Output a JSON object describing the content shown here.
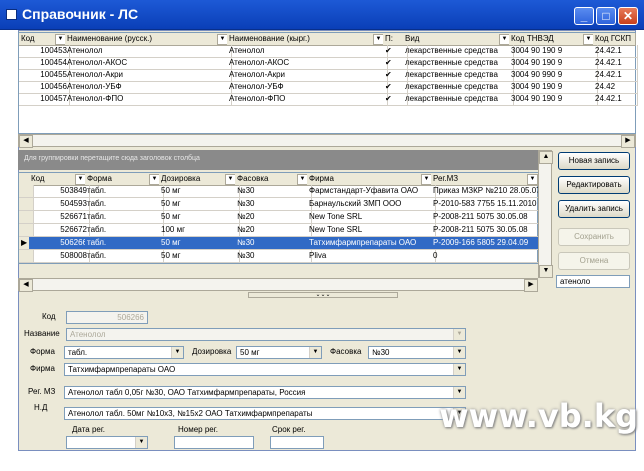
{
  "window": {
    "title": "Справочник - ЛС",
    "controls": {
      "minimize": "_",
      "maximize": "□",
      "close": "✕"
    }
  },
  "top_grid": {
    "columns": [
      "Код",
      "Наименование (русск.)",
      "Наименование (кырг.)",
      "П:",
      "Вид",
      "Код ТНВЭД",
      "Код ГСКП"
    ],
    "rows": [
      {
        "code": "100453",
        "name_ru": "Атенолол",
        "name_kg": "Атенолол",
        "check": "✔",
        "type": "лекарственные средства",
        "tnved": "3004 90 190 9",
        "gskp": "24.42.1"
      },
      {
        "code": "100454",
        "name_ru": "Атенолол-АКОС",
        "name_kg": "Атенолол-АКОС",
        "check": "✔",
        "type": "лекарственные средства",
        "tnved": "3004 90 190 9",
        "gskp": "24.42.1"
      },
      {
        "code": "100455",
        "name_ru": "Атенолол-Акри",
        "name_kg": "Атенолол-Акри",
        "check": "✔",
        "type": "лекарственные средства",
        "tnved": "3004 90 990 9",
        "gskp": "24.42.1"
      },
      {
        "code": "100456",
        "name_ru": "Атенолол-УБФ",
        "name_kg": "Атенолол-УБФ",
        "check": "✔",
        "type": "лекарственные средства",
        "tnved": "3004 90 190 9",
        "gskp": "24.42"
      },
      {
        "code": "100457",
        "name_ru": "Атенолол-ФПО",
        "name_kg": "Атенолол-ФПО",
        "check": "✔",
        "type": "лекарственные средства",
        "tnved": "3004 90 190 9",
        "gskp": "24.42.1"
      }
    ]
  },
  "group_hint": "Для группировки перетащите сюда заголовок столбца",
  "bottom_grid": {
    "columns": [
      "Код",
      "Форма",
      "Дозировка",
      "Фасовка",
      "Фирма",
      "Рег.МЗ"
    ],
    "rows": [
      {
        "code": "503849",
        "form": "табл.",
        "dose": "50 мг",
        "pack": "№30",
        "firm": "Фармстандарт-Уфавита ОАО",
        "reg": "Приказ МЗКР №210 28.05.07",
        "selected": false
      },
      {
        "code": "504593",
        "form": "табл.",
        "dose": "50 мг",
        "pack": "№30",
        "firm": "Барнаульский ЗМП ООО",
        "reg": "Р-2010-583 7755  15.11.2010",
        "selected": false
      },
      {
        "code": "526671",
        "form": "табл.",
        "dose": "50 мг",
        "pack": "№20",
        "firm": "New Tone SRL",
        "reg": "Р-2008-211 5075 30.05.08",
        "selected": false
      },
      {
        "code": "526672",
        "form": "табл.",
        "dose": "100 мг",
        "pack": "№20",
        "firm": "New Tone SRL",
        "reg": "Р-2008-211 5075 30.05.08",
        "selected": false
      },
      {
        "code": "506266",
        "form": "табл.",
        "dose": "50 мг",
        "pack": "№30",
        "firm": "Татхимфармпрепараты ОАО",
        "reg": "Р-2009-166 5805 29.04.09",
        "selected": true
      },
      {
        "code": "508008",
        "form": "табл.",
        "dose": "50 мг",
        "pack": "№30",
        "firm": "Pliva",
        "reg": "0",
        "selected": false
      }
    ]
  },
  "buttons": {
    "new_record": "Новая запись",
    "edit": "Редактировать",
    "delete": "Удалить запись",
    "save": "Сохранить",
    "cancel": "Отмена"
  },
  "search_value": "атеноло",
  "form": {
    "code_label": "Код",
    "code_value": "506266",
    "name_label": "Название",
    "name_value": "Атенолол",
    "form_label": "Форма",
    "form_value": "табл.",
    "dose_label": "Дозировка",
    "dose_value": "50 мг",
    "pack_label": "Фасовка",
    "pack_value": "№30",
    "firm_label": "Фирма",
    "firm_value": "Татхимфармпрепараты ОАО",
    "reg_label": "Рег. МЗ",
    "reg_value": "Атенолол табл 0,05г №30, ОАО Татхимфармпрепараты, Россия",
    "nd_label": "Н.Д",
    "nd_value": "Атенолол табл. 50мг №10х3, №15х2 ОАО Татхимфармпрепараты",
    "date_label": "Дата рег.",
    "number_label": "Номер рег.",
    "term_label": "Срок рег."
  },
  "watermark": "www.vb.kg"
}
